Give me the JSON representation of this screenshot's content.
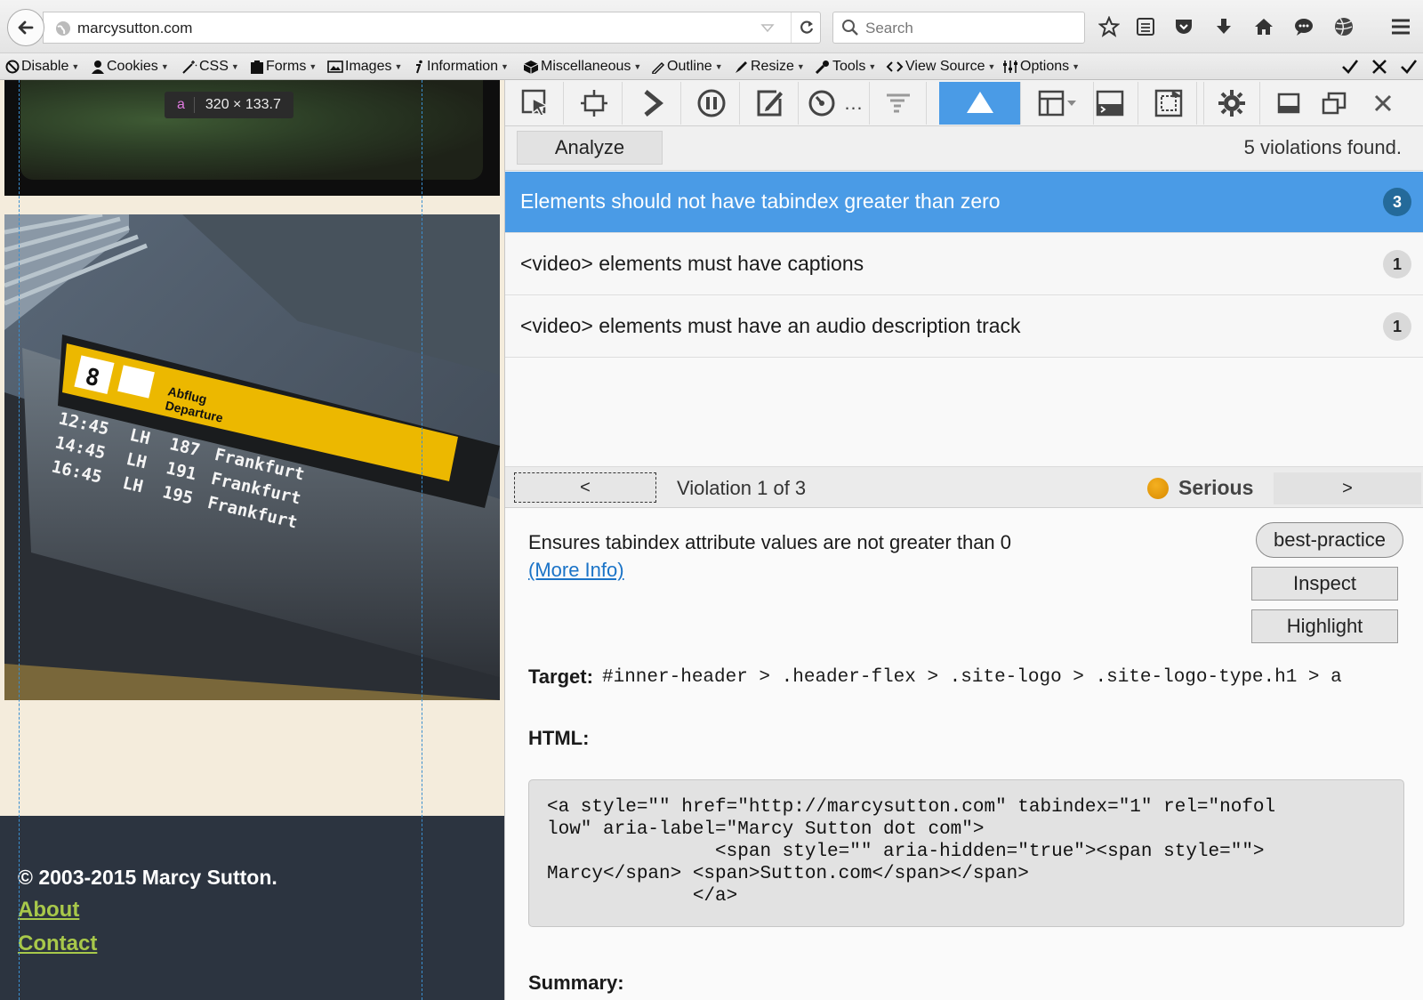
{
  "browser": {
    "url": "marcysutton.com",
    "search_placeholder": "Search"
  },
  "webdev_toolbar": {
    "items": [
      "Disable",
      "Cookies",
      "CSS",
      "Forms",
      "Images",
      "Information",
      "Miscellaneous",
      "Outline",
      "Resize",
      "Tools",
      "View Source",
      "Options"
    ]
  },
  "page": {
    "size_tooltip": {
      "tag": "a",
      "dimensions": "320 × 133.7"
    },
    "footer": {
      "copyright": "© 2003-2015 Marcy Sutton.",
      "links": [
        "About",
        "Contact"
      ]
    },
    "board": {
      "gate": "8",
      "departure_label_de": "Abflug",
      "departure_label_en": "Departure",
      "rows": [
        {
          "time": "12:45",
          "airline": "LH",
          "flight": "187",
          "destination": "Frankfurt"
        },
        {
          "time": "14:45",
          "airline": "LH",
          "flight": "191",
          "destination": "Frankfurt"
        },
        {
          "time": "16:45",
          "airline": "LH",
          "flight": "195",
          "destination": "Frankfurt"
        }
      ]
    }
  },
  "devtools": {
    "analyze_label": "Analyze",
    "violations_found": "5 violations found.",
    "rules": [
      {
        "title": "Elements should not have tabindex greater than zero",
        "count": "3",
        "selected": true
      },
      {
        "title": "<video> elements must have captions",
        "count": "1",
        "selected": false
      },
      {
        "title": "<video> elements must have an audio description track",
        "count": "1",
        "selected": false
      }
    ],
    "nav": {
      "prev_label": "<",
      "next_label": ">",
      "position": "Violation 1 of 3",
      "impact": "Serious",
      "impact_color": "#e89a00"
    },
    "detail": {
      "description": "Ensures tabindex attribute values are not greater than 0",
      "more_info": "(More Info)",
      "tag": "best-practice",
      "inspect_label": "Inspect",
      "highlight_label": "Highlight",
      "target_label": "Target:",
      "target_selector": "#inner-header > .header-flex > .site-logo > .site-logo-type.h1 > a",
      "html_label": "HTML:",
      "html_code": "<a style=\"\" href=\"http://marcysutton.com\" tabindex=\"1\" rel=\"nofol\nlow\" aria-label=\"Marcy Sutton dot com\">\n               <span style=\"\" aria-hidden=\"true\"><span style=\"\">\nMarcy</span> <span>Sutton.com</span></span>\n             </a>",
      "summary_label": "Summary:"
    }
  },
  "colors": {
    "accent": "#4a9be6",
    "footer_bg": "#2c3440",
    "footer_link": "#a8c84a"
  }
}
